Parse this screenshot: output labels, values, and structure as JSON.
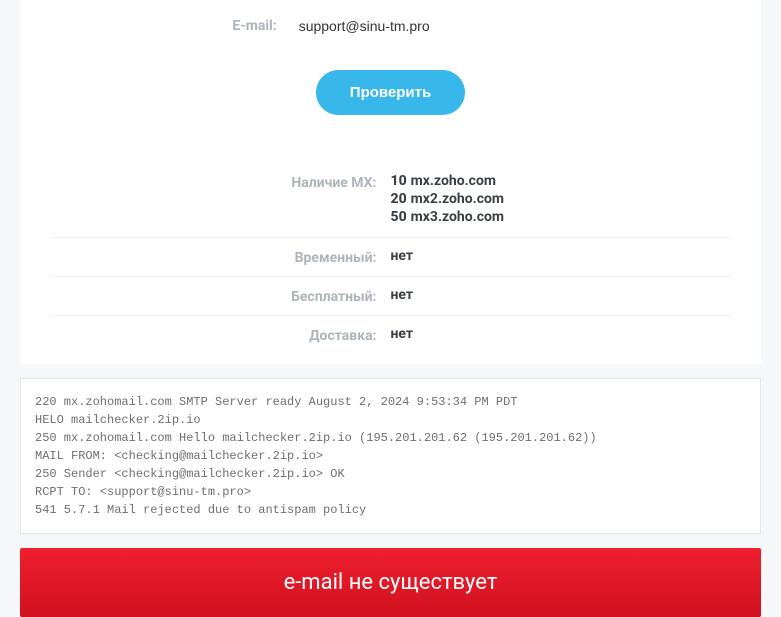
{
  "form": {
    "label": "E-mail:",
    "value": "support@sinu-tm.pro",
    "submit": "Проверить"
  },
  "results": {
    "mx": {
      "label": "Наличие MX:",
      "records": [
        {
          "priority": "10",
          "host": "mx.zoho.com"
        },
        {
          "priority": "20",
          "host": "mx2.zoho.com"
        },
        {
          "priority": "50",
          "host": "mx3.zoho.com"
        }
      ]
    },
    "temporary": {
      "label": "Временный:",
      "value": "нет"
    },
    "free": {
      "label": "Бесплатный:",
      "value": "нет"
    },
    "delivery": {
      "label": "Доставка:",
      "value": "нет"
    }
  },
  "log": "220 mx.zohomail.com SMTP Server ready August 2, 2024 9:53:34 PM PDT\nHELO mailchecker.2ip.io\n250 mx.zohomail.com Hello mailchecker.2ip.io (195.201.201.62 (195.201.201.62))\nMAIL FROM: <checking@mailchecker.2ip.io>\n250 Sender <checking@mailchecker.2ip.io> OK\nRCPT TO: <support@sinu-tm.pro>\n541 5.7.1 Mail rejected due to antispam policy",
  "banner": "e-mail не существует",
  "colors": {
    "accent": "#38b7ea",
    "error": "#e01b2a"
  }
}
